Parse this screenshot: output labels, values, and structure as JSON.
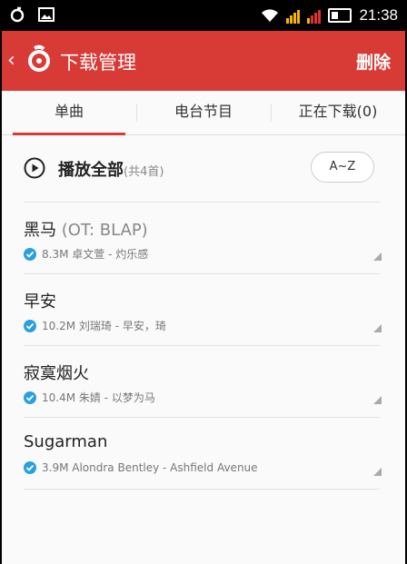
{
  "status_bar": {
    "time": "21:38"
  },
  "header": {
    "title": "下载管理",
    "delete_label": "删除"
  },
  "tabs": [
    {
      "label": "单曲",
      "active": true
    },
    {
      "label": "电台节目",
      "active": false
    },
    {
      "label": "正在下载(0)",
      "active": false
    }
  ],
  "play_all": {
    "label": "播放全部",
    "count": "(共4首)",
    "sort_label": "A~Z"
  },
  "songs": [
    {
      "title": "黑马",
      "alias": "(OT: BLAP)",
      "size": "8.3M",
      "info": "卓文萱 - 灼乐感"
    },
    {
      "title": "早安",
      "alias": "",
      "size": "10.2M",
      "info": "刘瑞琦 - 早安，琦"
    },
    {
      "title": "寂寞烟火",
      "alias": "",
      "size": "10.4M",
      "info": "朱婧 - 以梦为马"
    },
    {
      "title": "Sugarman",
      "alias": "",
      "size": "3.9M",
      "info": "Alondra Bentley - Ashfield Avenue"
    }
  ],
  "colors": {
    "accent": "#d83a35",
    "check": "#2aa0e0"
  }
}
